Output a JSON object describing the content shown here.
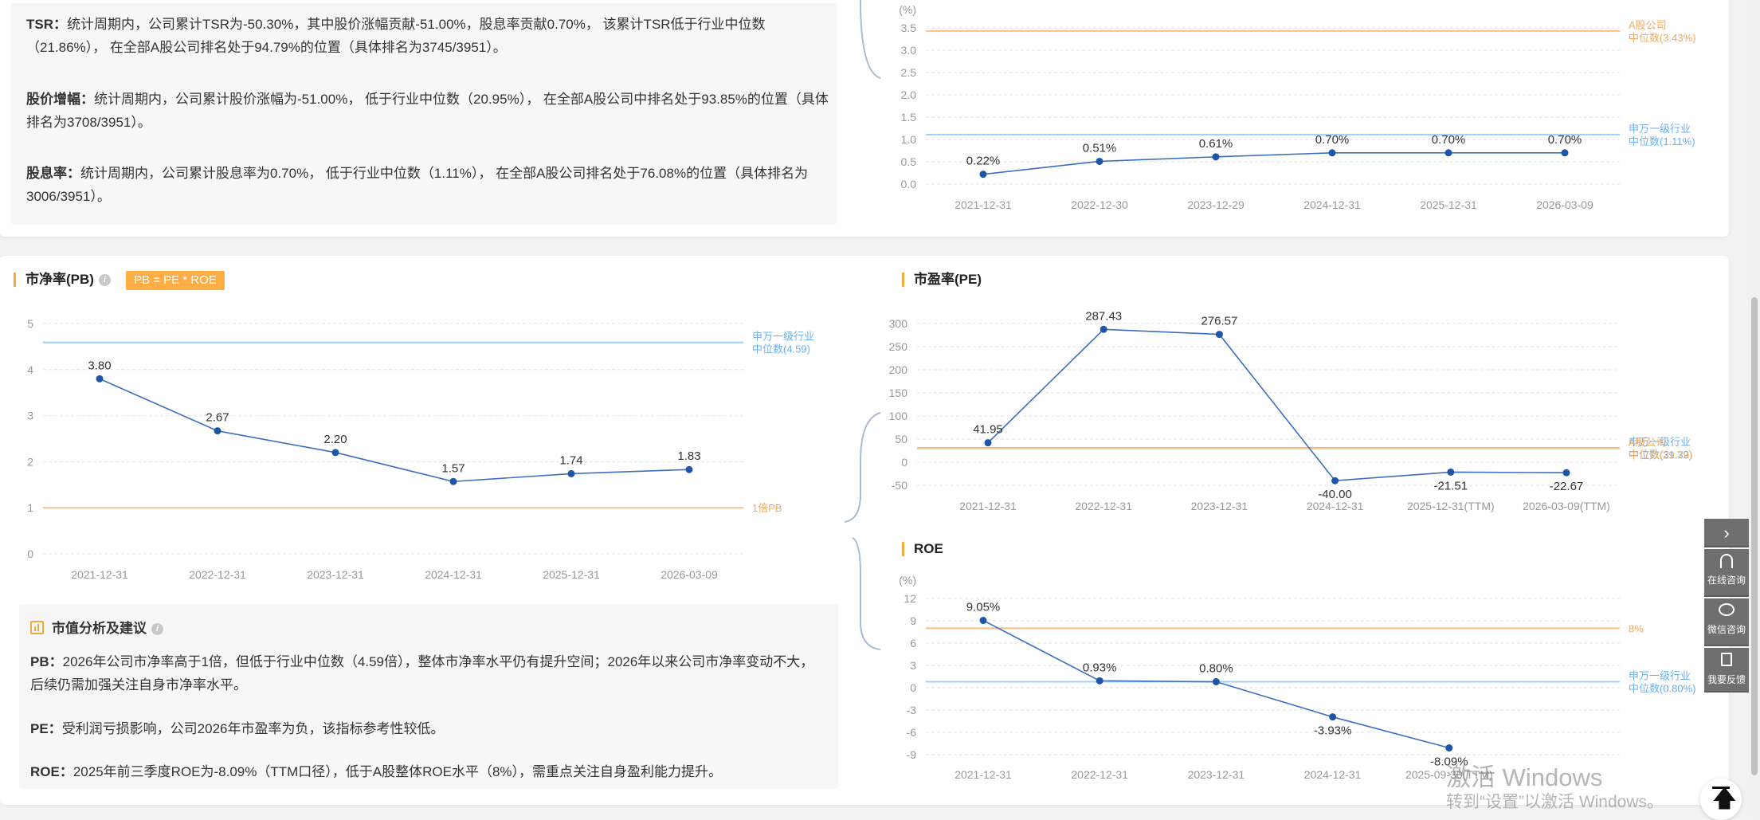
{
  "summary": {
    "items": [
      {
        "label": "TSR：",
        "text": "统计周期内，公司累计TSR为-50.30%，其中股价涨幅贡献-51.00%，股息率贡献0.70%， 该累计TSR低于行业中位数（21.86%）， 在全部A股公司排名处于94.79%的位置（具体排名为3745/3951）。"
      },
      {
        "label": "股价增幅：",
        "text": "统计周期内，公司累计股价涨幅为-51.00%， 低于行业中位数（20.95%）， 在全部A股公司中排名处于93.85%的位置（具体排名为3708/3951）。"
      },
      {
        "label": "股息率：",
        "text": "统计周期内，公司累计股息率为0.70%， 低于行业中位数（1.11%）， 在全部A股公司排名处于76.08%的位置（具体排名为3006/3951）。"
      }
    ]
  },
  "pb_section": {
    "title": "市净率(PB)",
    "info": "i",
    "formula_badge": "PB = PE * ROE"
  },
  "pe_section": {
    "title": "市盈率(PE)"
  },
  "roe_section": {
    "title": "ROE"
  },
  "analysis": {
    "title": "市值分析及建议",
    "info": "i",
    "items": [
      {
        "label": "PB：",
        "text": "2026年公司市净率高于1倍，但低于行业中位数（4.59倍），整体市净率水平仍有提升空间；2026年以来公司市净率变动不大，后续仍需加强关注自身市净率水平。"
      },
      {
        "label": "PE：",
        "text": "受利润亏损影响，公司2026年市盈率为负，该指标参考性较低。"
      },
      {
        "label": "ROE：",
        "text": "2025年前三季度ROE为-8.09%（TTM口径），低于A股整体ROE水平（8%），需重点关注自身盈利能力提升。"
      }
    ]
  },
  "chart_data": [
    {
      "id": "dividend",
      "type": "line",
      "title": "",
      "ylabel": "(%)",
      "categories": [
        "2021-12-31",
        "2022-12-30",
        "2023-12-29",
        "2024-12-31",
        "2025-12-31",
        "2026-03-09"
      ],
      "values": [
        0.22,
        0.51,
        0.61,
        0.7,
        0.7,
        0.7
      ],
      "value_labels": [
        "0.22%",
        "0.51%",
        "0.61%",
        "0.70%",
        "0.70%",
        "0.70%"
      ],
      "yticks": [
        "0.0",
        "0.5",
        "1.0",
        "1.5",
        "2.0",
        "2.5",
        "3.0",
        "3.5"
      ],
      "ylim": [
        0,
        3.5
      ],
      "grid": true,
      "reference_lines": [
        {
          "value": 3.43,
          "line1": "A股公司",
          "line2": "中位数(3.43%)",
          "color": "#f5c08a",
          "text_color": "#f3a85a"
        },
        {
          "value": 1.11,
          "line1": "申万一级行业",
          "line2": "中位数(1.11%)",
          "color": "#9fd0fb",
          "text_color": "#6ab0f3"
        }
      ]
    },
    {
      "id": "pb",
      "type": "line",
      "title": "市净率(PB)",
      "ylabel": "",
      "categories": [
        "2021-12-31",
        "2022-12-31",
        "2023-12-31",
        "2024-12-31",
        "2025-12-31",
        "2026-03-09"
      ],
      "values": [
        3.8,
        2.67,
        2.2,
        1.57,
        1.74,
        1.83
      ],
      "value_labels": [
        "3.80",
        "2.67",
        "2.20",
        "1.57",
        "1.74",
        "1.83"
      ],
      "yticks": [
        "0",
        "1",
        "2",
        "3",
        "4",
        "5"
      ],
      "ylim": [
        0,
        5
      ],
      "grid": true,
      "reference_lines": [
        {
          "value": 4.59,
          "line1": "申万一级行业",
          "line2": "中位数(4.59)",
          "color": "#9fd0fb",
          "text_color": "#6ab0f3"
        },
        {
          "value": 1,
          "line1": "1倍PB",
          "line2": "",
          "color": "#f5c08a",
          "text_color": "#f3a85a"
        }
      ]
    },
    {
      "id": "pe",
      "type": "line",
      "title": "市盈率(PE)",
      "ylabel": "",
      "categories": [
        "2021-12-31",
        "2022-12-31",
        "2023-12-31",
        "2024-12-31",
        "2025-12-31(TTM)",
        "2026-03-09(TTM)"
      ],
      "values": [
        41.95,
        287.43,
        276.57,
        -40.0,
        -21.51,
        -22.67
      ],
      "value_labels": [
        "41.95",
        "287.43",
        "276.57",
        "-40.00",
        "-21.51",
        "-22.67"
      ],
      "yticks": [
        "-50",
        "0",
        "50",
        "100",
        "150",
        "200",
        "250",
        "300"
      ],
      "ylim": [
        -50,
        300
      ],
      "grid": true,
      "reference_lines": [
        {
          "value": 31.32,
          "line1": "申万一级行业",
          "line2": "中位数(31.32)",
          "color": "#9fd0fb",
          "text_color": "#6ab0f3"
        },
        {
          "value": 29.79,
          "line1": "A股公司",
          "line2": "中位数(29.79)",
          "color": "#f5c08a",
          "text_color": "#f3a85a"
        }
      ]
    },
    {
      "id": "roe",
      "type": "line",
      "title": "ROE",
      "ylabel": "(%)",
      "categories": [
        "2021-12-31",
        "2022-12-31",
        "2023-12-31",
        "2024-12-31",
        "2025-09-30(TTM)"
      ],
      "values": [
        9.05,
        0.93,
        0.8,
        -3.93,
        -8.09
      ],
      "value_labels": [
        "9.05%",
        "0.93%",
        "0.80%",
        "-3.93%",
        "-8.09%"
      ],
      "yticks": [
        "-9",
        "-6",
        "-3",
        "0",
        "3",
        "6",
        "9",
        "12"
      ],
      "ylim": [
        -9,
        12
      ],
      "grid": true,
      "reference_lines": [
        {
          "value": 8,
          "line1": "8%",
          "line2": "",
          "color": "#f5c08a",
          "text_color": "#f3a85a"
        },
        {
          "value": 0.8,
          "line1": "申万一级行业",
          "line2": "中位数(0.80%)",
          "color": "#9fd0fb",
          "text_color": "#6ab0f3"
        }
      ]
    }
  ],
  "colors": {
    "series_line": "#3b6fc2",
    "series_point": "#1f55a6",
    "accent": "#f5a83c",
    "grid": "#e2e2e2",
    "axis_text": "#999999"
  },
  "side_tools": {
    "collapse_icon": "chevron-right-icon",
    "items": [
      {
        "icon": "headset-icon",
        "label": "在线咨询"
      },
      {
        "icon": "wechat-icon",
        "label": "微信咨询"
      },
      {
        "icon": "feedback-icon",
        "label": "我要反馈"
      }
    ],
    "back_to_top_icon": "arrow-up-to-top-icon"
  },
  "watermark": {
    "line1": "激活 Windows",
    "line2": "转到“设置”以激活 Windows。"
  }
}
